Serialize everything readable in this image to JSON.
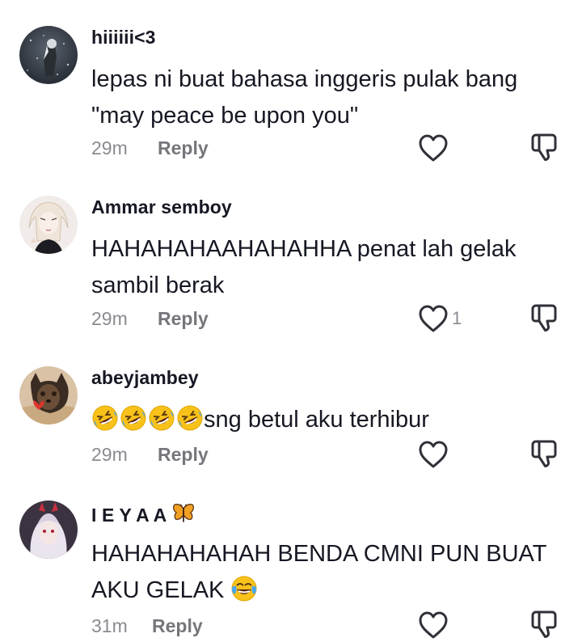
{
  "comments": [
    {
      "username": "hiiiiii<3",
      "text": "lepas ni buat bahasa inggeris pulak bang \"may peace be upon you\"",
      "time": "29m",
      "reply_label": "Reply",
      "like_count": ""
    },
    {
      "username": "Ammar semboy",
      "text": "HAHAHAHAAHAHAHHA penat lah gelak sambil berak",
      "time": "29m",
      "reply_label": "Reply",
      "like_count": "1"
    },
    {
      "username": "abeyjambey",
      "text_emoji_prefix": [
        "rolling-on-floor-laughing",
        "rolling-on-floor-laughing",
        "rolling-on-floor-laughing",
        "rolling-on-floor-laughing"
      ],
      "text": "sng betul aku terhibur",
      "time": "29m",
      "reply_label": "Reply",
      "like_count": ""
    },
    {
      "username": "I E Y A A",
      "username_emoji": "butterfly",
      "text": "HAHAHAHAHAH BENDA CMNI PUN BUAT AKU GELAK",
      "text_emoji_suffix": "face-with-tears-of-joy",
      "time": "31m",
      "reply_label": "Reply",
      "like_count": ""
    }
  ],
  "icons": {
    "like": "heart-outline-icon",
    "dislike": "thumbs-down-outline-icon"
  },
  "colors": {
    "text": "#161823",
    "secondary": "#8a8b91",
    "icon": "#2f3038"
  }
}
